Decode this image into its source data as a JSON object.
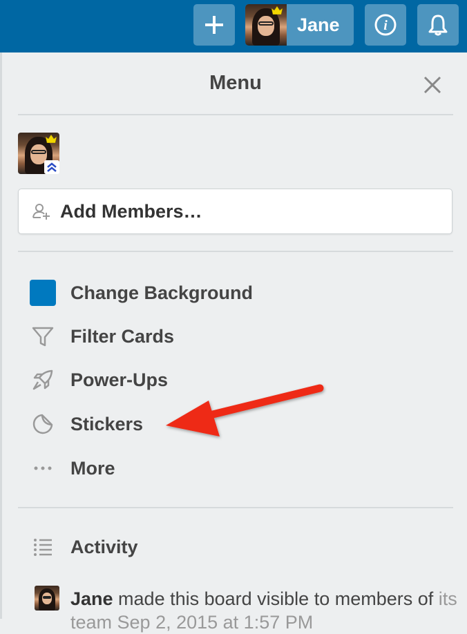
{
  "header": {
    "add_icon": "plus-icon",
    "user_name": "Jane",
    "info_icon": "info-icon",
    "bell_icon": "bell-icon"
  },
  "menu": {
    "title": "Menu",
    "close_icon": "close-icon",
    "add_members_label": "Add Members…",
    "items": [
      {
        "label": "Change Background",
        "icon": "background-swatch"
      },
      {
        "label": "Filter Cards",
        "icon": "filter-icon"
      },
      {
        "label": "Power-Ups",
        "icon": "rocket-icon"
      },
      {
        "label": "Stickers",
        "icon": "sticker-icon"
      },
      {
        "label": "More",
        "icon": "more-icon"
      }
    ],
    "activity_label": "Activity",
    "activity_entry": {
      "user": "Jane",
      "text": " made this board visible to members of",
      "cut_off": "its team Sep 2, 2015 at 1:57 PM"
    }
  },
  "colors": {
    "header_bg": "#0067a3",
    "header_button": "#4d95bf",
    "panel_bg": "#edeff0",
    "board_color": "#0079bf",
    "arrow": "#ee2a17"
  }
}
